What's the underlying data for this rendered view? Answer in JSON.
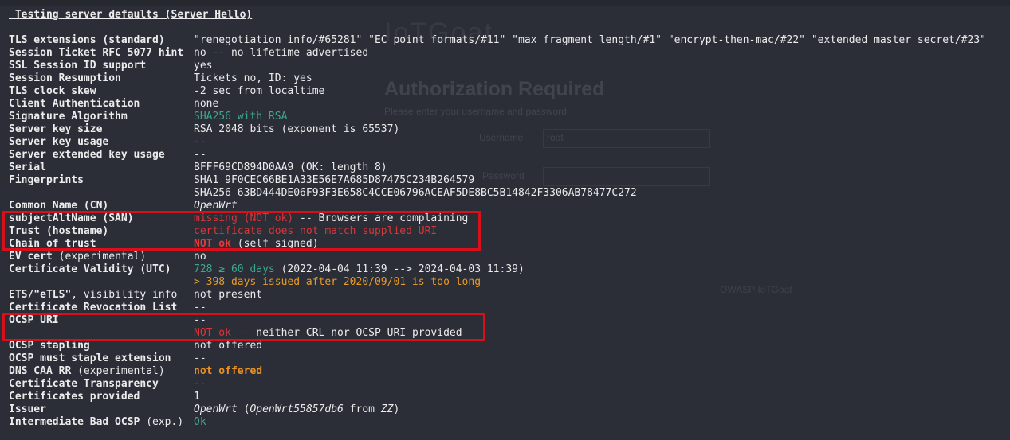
{
  "background_window": {
    "title": "Authorization Required",
    "subtitle": "Please enter your username and password.",
    "username_label": "Username",
    "username_value": "root",
    "password_label": "Password",
    "footer": "OWASP IoTGoat"
  },
  "heading": " Testing server defaults (Server Hello)",
  "rows": {
    "tls_ext": {
      "label": "TLS extensions (standard)",
      "value": "\"renegotiation info/#65281\" \"EC point formats/#11\" \"max fragment length/#1\" \"encrypt-then-mac/#22\" \"extended master secret/#23\""
    },
    "ticket": {
      "label": "Session Ticket RFC 5077 hint",
      "value": "no -- no lifetime advertised"
    },
    "sessid": {
      "label": "SSL Session ID support",
      "value": "yes"
    },
    "resumption": {
      "label": "Session Resumption",
      "value": "Tickets no, ID: yes"
    },
    "clock": {
      "label": "TLS clock skew",
      "value": "-2 sec from localtime"
    },
    "clientauth": {
      "label": "Client Authentication",
      "value": "none"
    },
    "sigalg": {
      "label": "Signature Algorithm",
      "value": "SHA256 with RSA"
    },
    "keysize": {
      "label": "Server key size",
      "value": "RSA 2048 bits (exponent is 65537)"
    },
    "keyusage": {
      "label": "Server key usage",
      "value": "--"
    },
    "extkeyusage": {
      "label": "Server extended key usage",
      "value": "--"
    },
    "serial": {
      "label": "Serial",
      "value": "BFFF69CD894D0AA9 (OK: length 8)"
    },
    "fingerprints": {
      "label": "Fingerprints",
      "value": "SHA1 9F0CEC66BE1A33E56E7A685D87475C234B264579",
      "value2": "SHA256 63BD444DE06F93F3E658C4CCE06796ACEAF5DE8BC5B14842F3306AB78477C272"
    },
    "cn": {
      "label": "Common Name (CN)",
      "value": "OpenWrt"
    },
    "san": {
      "label": "subjectAltName (SAN)",
      "value_red": "missing (NOT ok)",
      "value_rest": " -- Browsers are complaining"
    },
    "trust": {
      "label": "Trust (hostname)",
      "value": "certificate does not match supplied URI"
    },
    "chain": {
      "label": "Chain of trust",
      "value_red": "NOT ok",
      "value_rest": " (self signed)"
    },
    "ev": {
      "label_bold": "EV cert",
      "label_rest": " (experimental)",
      "value": "no"
    },
    "validity": {
      "label": "Certificate Validity (UTC)",
      "value_green": "728 ≥ 60 days",
      "value_rest": " (2022-04-04 11:39 --> 2024-04-03 11:39)",
      "value2": "> 398 days issued after 2020/09/01 is too long"
    },
    "etls": {
      "label_bold": "ETS/\"eTLS\"",
      "label_rest": ", visibility info",
      "value": "not present"
    },
    "crl": {
      "label": "Certificate Revocation List",
      "value": "--"
    },
    "ocsp": {
      "label": "OCSP URI",
      "value": "--",
      "value2_red": "NOT ok -- ",
      "value2_rest": "neither CRL nor OCSP URI provided"
    },
    "stapling": {
      "label": "OCSP stapling",
      "value": "not offered"
    },
    "muststaple": {
      "label": "OCSP must staple extension",
      "value": "--"
    },
    "caa": {
      "label_bold": "DNS CAA RR",
      "label_rest": " (experimental)",
      "value": "not offered"
    },
    "ct": {
      "label": "Certificate Transparency",
      "value": "--"
    },
    "certs": {
      "label": "Certificates provided",
      "value": "1"
    },
    "issuer": {
      "label": "Issuer",
      "value_it1": "OpenWrt",
      "value_p1": " (",
      "value_it2": "OpenWrt55857db6",
      "value_p2": " from ",
      "value_it3": "ZZ",
      "value_p3": ")"
    },
    "badocsp": {
      "label_bold": "Intermediate Bad OCSP",
      "label_rest": " (exp.)",
      "value": "Ok"
    }
  },
  "colors": {
    "background": "#2b2d37",
    "red": "#d8373a",
    "green": "#3ea88f",
    "orange": "#e79a28",
    "highlight_box": "#d9101c"
  }
}
